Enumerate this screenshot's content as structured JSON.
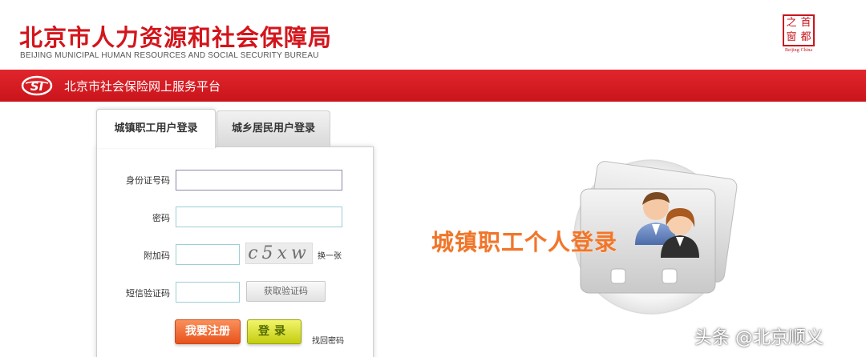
{
  "header": {
    "title_cn": "北京市人力资源和社会保障局",
    "title_en": "BEIJING MUNICIPAL HUMAN RESOURCES AND SOCIAL SECURITY BUREAU",
    "seal_chars": [
      "之",
      "首",
      "窗",
      "都"
    ],
    "seal_caption": "Beijing·China"
  },
  "banner": {
    "logo_text": "SI",
    "platform_title": "北京市社会保险网上服务平台"
  },
  "tabs": [
    {
      "label": "城镇职工用户登录",
      "active": true
    },
    {
      "label": "城乡居民用户登录",
      "active": false
    }
  ],
  "form": {
    "id_label": "身份证号码",
    "id_value": "",
    "password_label": "密码",
    "password_value": "",
    "extra_code_label": "附加码",
    "extra_code_value": "",
    "captcha_text": "c5xw",
    "change_captcha": "换一张",
    "sms_label": "短信验证码",
    "sms_value": "",
    "sms_button": "获取验证码",
    "register_button": "我要注册",
    "login_button": "登录",
    "forgot_password": "找回密码"
  },
  "promo": {
    "text": "城镇职工个人登录"
  },
  "watermark": {
    "text": "头条 @北京顺义"
  },
  "colors": {
    "brand_red": "#d3151c",
    "promo_orange": "#f0762b",
    "register_orange": "#e8521c",
    "login_yellow": "#c4cd10",
    "input_border": "#9ccfd6"
  }
}
